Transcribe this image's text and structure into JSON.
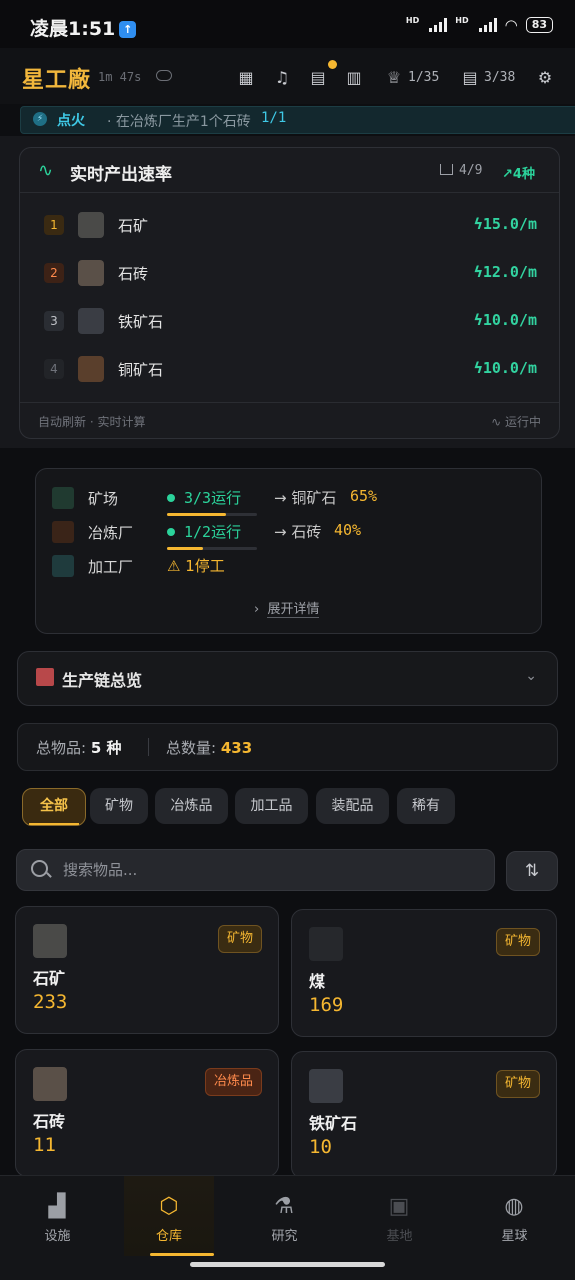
{
  "status_bar": {
    "time": "凌晨1:51",
    "battery": "83"
  },
  "header": {
    "title": "星工廠",
    "timer": "1m 47s",
    "achievements": "1/35",
    "quests": "3/38"
  },
  "task": {
    "tag": "点火",
    "text": "· 在冶炼厂生产1个石砖",
    "progress": "1/1"
  },
  "rates": {
    "title": "实时产出速率",
    "factories": "4/9",
    "trend": "4种",
    "items": [
      {
        "rank": "1",
        "name": "石矿",
        "rate": "15.0/m"
      },
      {
        "rank": "2",
        "name": "石砖",
        "rate": "12.0/m"
      },
      {
        "rank": "3",
        "name": "铁矿石",
        "rate": "10.0/m"
      },
      {
        "rank": "4",
        "name": "铜矿石",
        "rate": "10.0/m"
      }
    ],
    "footer_left": "自动刷新 · 实时计算",
    "footer_right": "运行中"
  },
  "facilities": [
    {
      "name": "矿场",
      "running": "3/3运行",
      "target": "→ 铜矿石",
      "pct": "65%",
      "progress": 0.65
    },
    {
      "name": "冶炼厂",
      "running": "1/2运行",
      "target": "→ 石砖",
      "pct": "40%",
      "progress": 0.4
    },
    {
      "name": "加工厂",
      "warn": "⚠ 1停工"
    }
  ],
  "expand_label": "展开详情",
  "chain_title": "生产链总览",
  "stats": {
    "items_label": "总物品:",
    "items_value": "5 种",
    "count_label": "总数量:",
    "count_value": "433"
  },
  "filters": [
    "全部",
    "矿物",
    "冶炼品",
    "加工品",
    "装配品",
    "稀有"
  ],
  "search": {
    "placeholder": "搜索物品..."
  },
  "inventory": [
    {
      "name": "石矿",
      "count": "233",
      "tag": "矿物"
    },
    {
      "name": "煤",
      "count": "169",
      "tag": "矿物"
    },
    {
      "name": "石砖",
      "count": "11",
      "tag": "冶炼品"
    },
    {
      "name": "铁矿石",
      "count": "10",
      "tag": "矿物"
    }
  ],
  "nav": [
    "设施",
    "仓库",
    "研究",
    "基地",
    "星球"
  ],
  "colors": {
    "accent": "#f5b731",
    "green": "#2bd39b",
    "cyan": "#3fc9e6",
    "background": "#0d0e11"
  }
}
